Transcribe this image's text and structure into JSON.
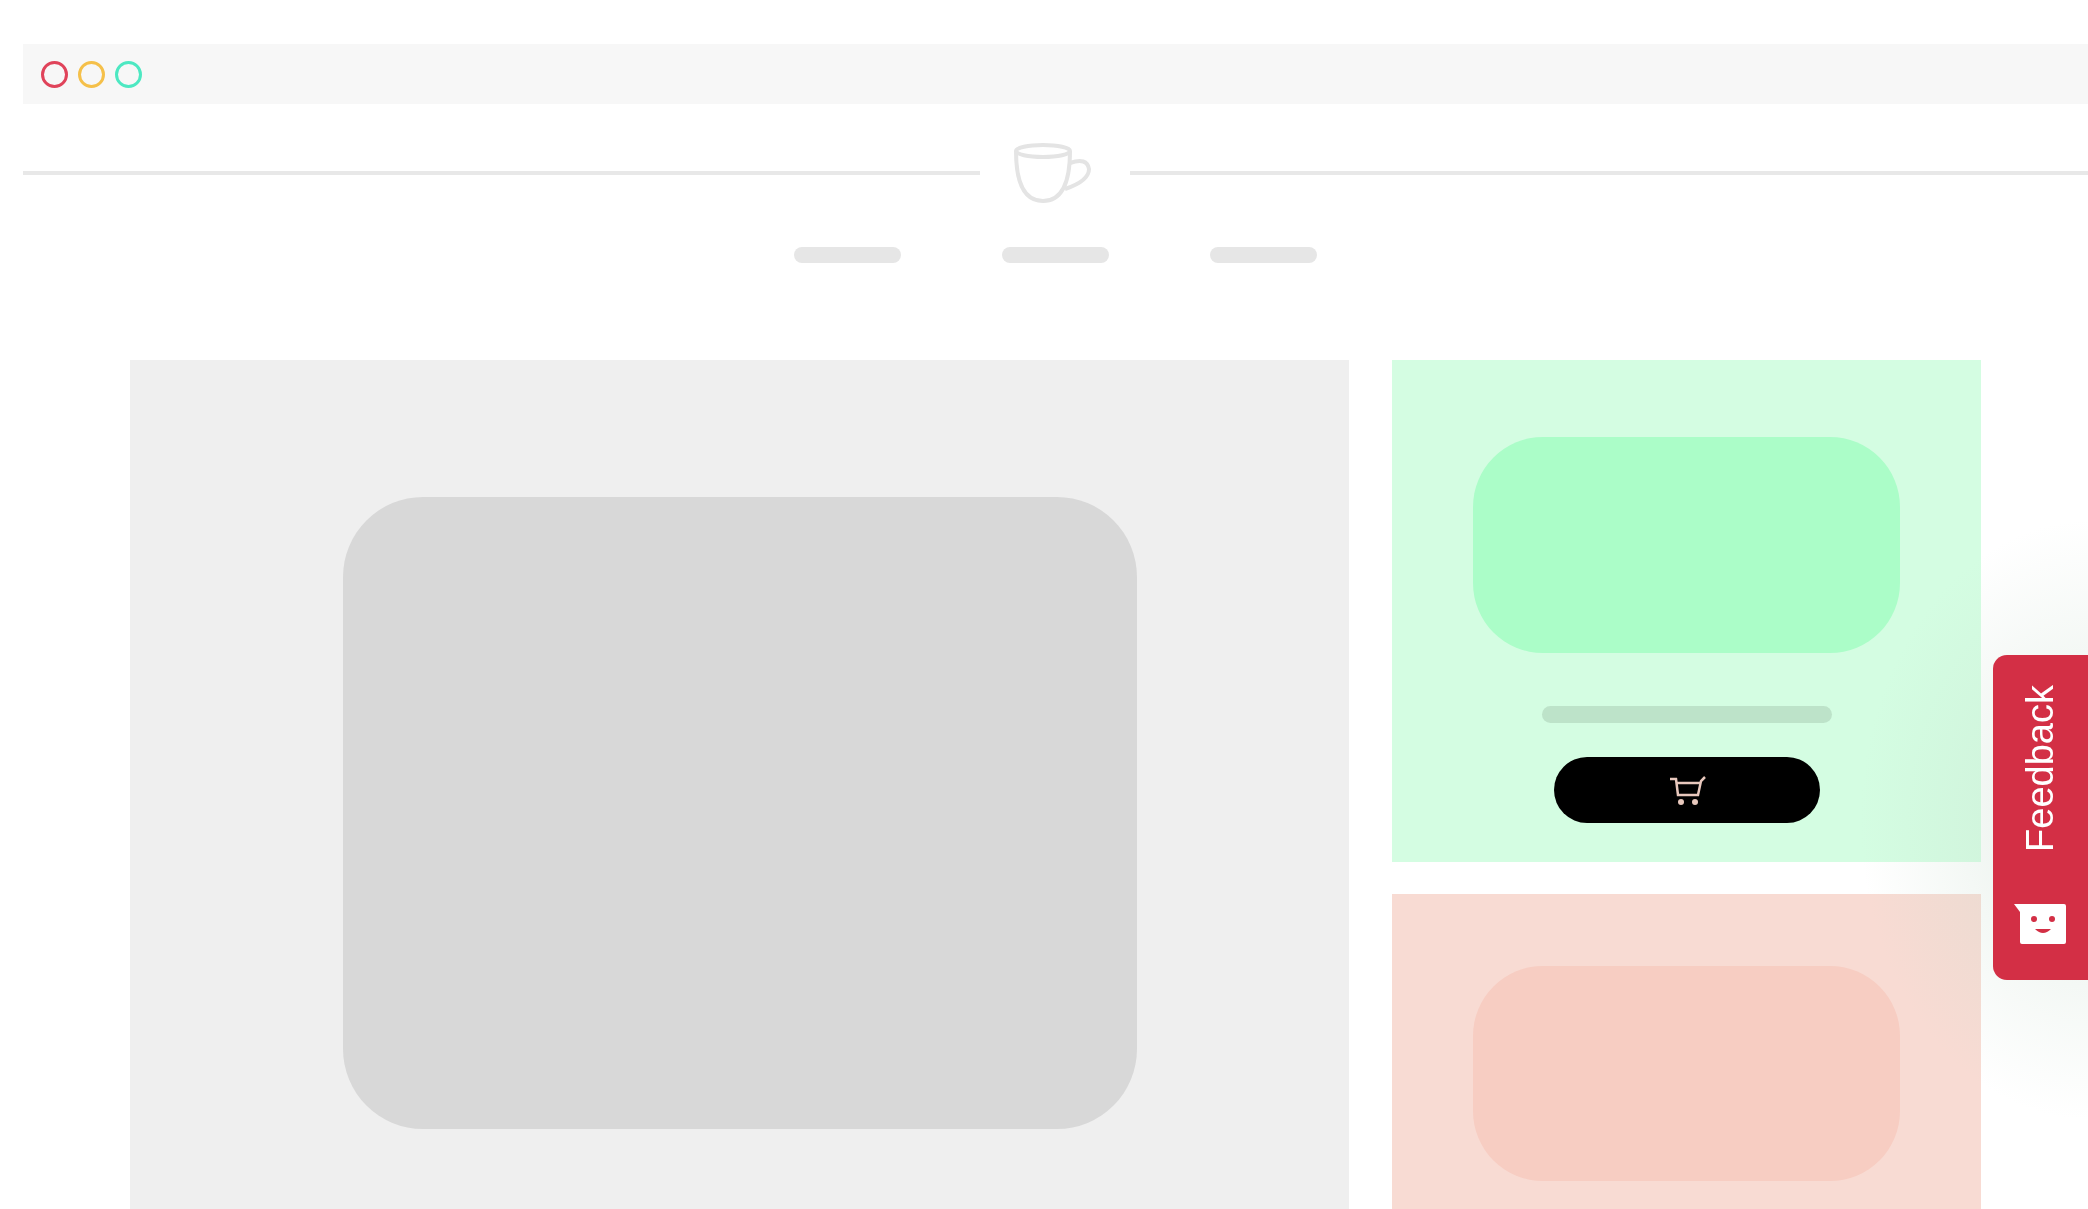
{
  "window_controls": [
    {
      "color": "#e0435a"
    },
    {
      "color": "#f5c04a"
    },
    {
      "color": "#4de8c2"
    }
  ],
  "feedback_tab": {
    "label": "Feedback"
  }
}
